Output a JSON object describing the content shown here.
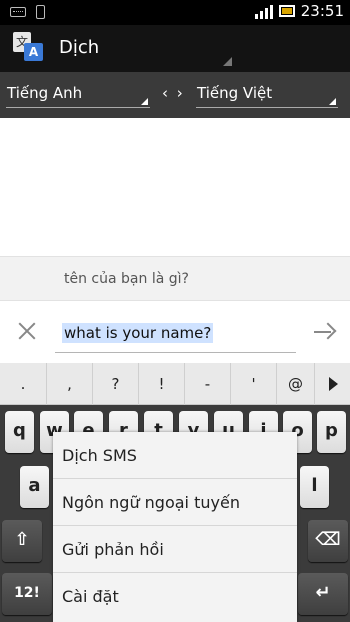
{
  "status_bar": {
    "time": "23:51"
  },
  "action_bar": {
    "title": "Dịch",
    "icon_glyph_back": "文",
    "icon_glyph_front": "A"
  },
  "languages": {
    "source": "Tiếng Anh",
    "target": "Tiếng Việt",
    "swap_label": "‹ ›"
  },
  "suggestion": {
    "text": "tên của bạn là gì?"
  },
  "input": {
    "value": "what is your name?"
  },
  "keyboard": {
    "symbols": [
      ".",
      ",",
      "?",
      "!",
      "-",
      "'",
      "@"
    ],
    "row1_visible": [
      "q",
      "w",
      "e",
      "r",
      "t",
      "y",
      "u",
      "i",
      "o",
      "p"
    ],
    "row2_visible": [
      "a",
      "l"
    ],
    "shift_label": "⇧",
    "backspace_label": "⌫",
    "symbol_key_label": "12!",
    "enter_label": "↵"
  },
  "menu": {
    "items": [
      {
        "label": "Dịch SMS"
      },
      {
        "label": "Ngôn ngữ ngoại tuyến"
      },
      {
        "label": "Gửi phản hồi"
      },
      {
        "label": "Cài đặt"
      }
    ]
  },
  "icons": {
    "keyboard_icon": "keyboard-icon",
    "phone_icon": "phone-icon",
    "signal_icon": "signal-icon",
    "battery_icon": "battery-icon",
    "clear_icon": "close-icon",
    "go_icon": "arrow-right-icon"
  }
}
